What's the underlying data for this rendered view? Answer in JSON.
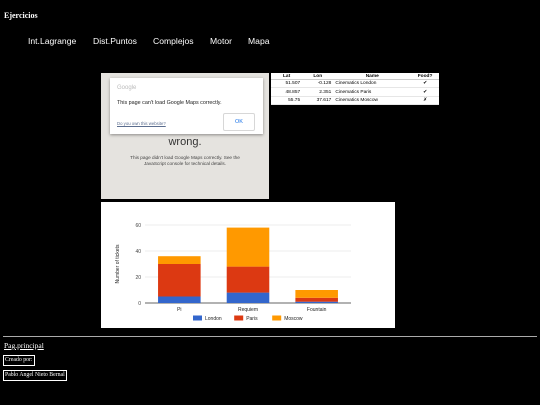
{
  "site_title": "Ejercicios",
  "nav": [
    "Int.Lagrange",
    "Dist.Puntos",
    "Complejos",
    "Motor",
    "Mapa"
  ],
  "map_error": {
    "google_logo": "Google",
    "dialog_message": "This page can't load Google Maps correctly.",
    "dialog_link": "Do you own this website?",
    "ok_button": "OK",
    "bg_message": "wrong.",
    "bg_detail": "This page didn't load Google Maps correctly. See the JavaScript console for technical details."
  },
  "table": {
    "headers": [
      "Lat",
      "Lon",
      "Name",
      "Food?"
    ],
    "rows": [
      [
        "51.507",
        "-0.128",
        "Cinematics London",
        "✔"
      ],
      [
        "48.857",
        "2.351",
        "Cinematics Paris",
        "✔"
      ],
      [
        "55.75",
        "37.617",
        "Cinematics Moscow",
        "✗"
      ]
    ]
  },
  "chart_data": {
    "type": "bar",
    "stacked": true,
    "categories": [
      "Pi",
      "Requiem",
      "Fountain"
    ],
    "series": [
      {
        "name": "London",
        "values": [
          5,
          8,
          1
        ],
        "color": "#3366cc"
      },
      {
        "name": "Paris",
        "values": [
          25,
          20,
          3
        ],
        "color": "#dc3912"
      },
      {
        "name": "Moscow",
        "values": [
          6,
          30,
          6
        ],
        "color": "#ff9900"
      }
    ],
    "ylabel": "Number of tickets",
    "xlabel": "",
    "ylim": [
      0,
      60
    ],
    "yticks": [
      "0",
      "20",
      "40",
      "60"
    ],
    "grid": true,
    "legend_position": "bottom"
  },
  "footer": {
    "home_link": "Pag.principal",
    "created_by": "Creado por:",
    "author": "Pablo Angel Nieto Bernal"
  }
}
